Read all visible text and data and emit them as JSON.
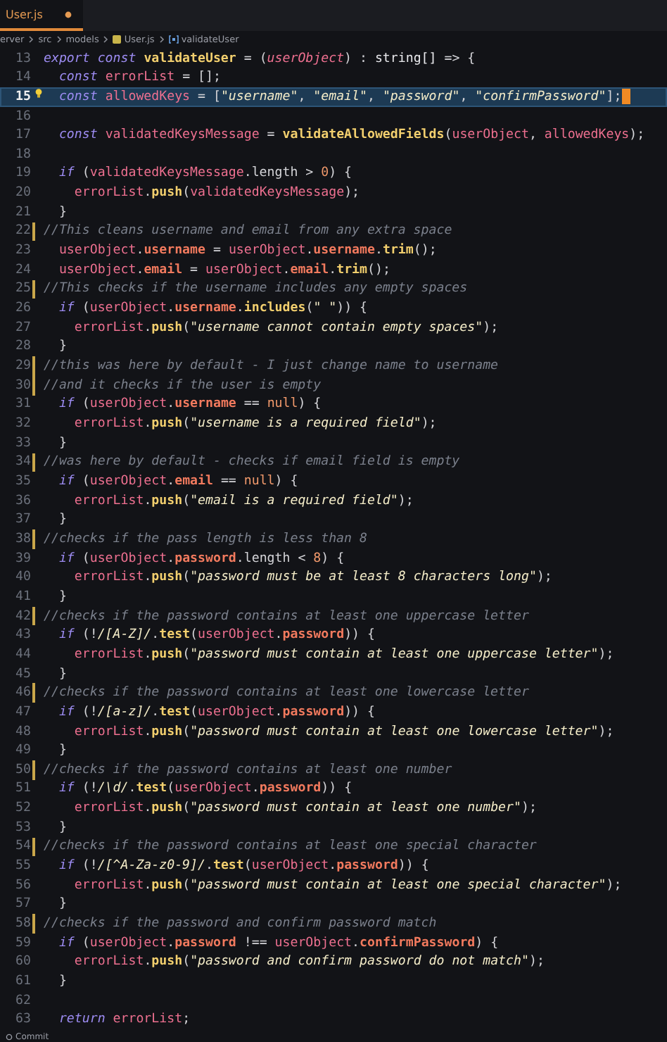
{
  "tab": {
    "label": "User.js",
    "modified": true
  },
  "breadcrumb": [
    {
      "text": "erver",
      "kind": "folder"
    },
    {
      "text": "src",
      "kind": "folder"
    },
    {
      "text": "models",
      "kind": "folder"
    },
    {
      "text": "User.js",
      "kind": "file"
    },
    {
      "text": "validateUser",
      "kind": "symbol"
    }
  ],
  "editor": {
    "lines": [
      {
        "number": "13",
        "selected": false,
        "modified": false,
        "tokens": [
          {
            "kind": "keyword",
            "text": "export const "
          },
          {
            "kind": "function",
            "text": "validateUser"
          },
          {
            "kind": "punct",
            "text": " = ("
          },
          {
            "kind": "param",
            "text": "userObject"
          },
          {
            "kind": "punct",
            "text": ") : "
          },
          {
            "kind": "type",
            "text": "string[]"
          },
          {
            "kind": "punct",
            "text": " => {"
          }
        ]
      },
      {
        "number": "14",
        "selected": false,
        "modified": false,
        "tokens": [
          {
            "kind": "keyword",
            "text": "  const "
          },
          {
            "kind": "variable",
            "text": "errorList"
          },
          {
            "kind": "punct",
            "text": " = [];"
          }
        ]
      },
      {
        "number": "15",
        "selected": true,
        "modified": false,
        "tokens": [
          {
            "kind": "keyword",
            "text": "  const "
          },
          {
            "kind": "variable",
            "text": "allowedKeys"
          },
          {
            "kind": "punct",
            "text": " = ["
          },
          {
            "kind": "string",
            "text": "\"username\""
          },
          {
            "kind": "punct",
            "text": ", "
          },
          {
            "kind": "string",
            "text": "\"email\""
          },
          {
            "kind": "punct",
            "text": ", "
          },
          {
            "kind": "string",
            "text": "\"password\""
          },
          {
            "kind": "punct",
            "text": ", "
          },
          {
            "kind": "string",
            "text": "\"confirmPassword\""
          },
          {
            "kind": "punct",
            "text": "];"
          }
        ]
      },
      {
        "number": "16",
        "selected": false,
        "modified": false
      },
      {
        "number": "17",
        "selected": false,
        "modified": false,
        "tokens": [
          {
            "kind": "keyword",
            "text": "  const "
          },
          {
            "kind": "variable",
            "text": "validatedKeysMessage"
          },
          {
            "kind": "punct",
            "text": " = "
          },
          {
            "kind": "function",
            "text": "validateAllowedFields"
          },
          {
            "kind": "punct",
            "text": "("
          },
          {
            "kind": "variable",
            "text": "userObject"
          },
          {
            "kind": "punct",
            "text": ", "
          },
          {
            "kind": "variable",
            "text": "allowedKeys"
          },
          {
            "kind": "punct",
            "text": ");"
          }
        ]
      },
      {
        "number": "18",
        "selected": false,
        "modified": false
      },
      {
        "number": "19",
        "selected": false,
        "modified": false,
        "tokens": [
          {
            "kind": "keyword",
            "text": "  if "
          },
          {
            "kind": "punct",
            "text": "("
          },
          {
            "kind": "variable",
            "text": "validatedKeysMessage"
          },
          {
            "kind": "punct",
            "text": ".length > "
          },
          {
            "kind": "number",
            "text": "0"
          },
          {
            "kind": "punct",
            "text": ") {"
          }
        ]
      },
      {
        "number": "20",
        "selected": false,
        "modified": false,
        "tokens": [
          {
            "kind": "variable",
            "text": "    errorList"
          },
          {
            "kind": "punct",
            "text": "."
          },
          {
            "kind": "function",
            "text": "push"
          },
          {
            "kind": "punct",
            "text": "("
          },
          {
            "kind": "variable",
            "text": "validatedKeysMessage"
          },
          {
            "kind": "punct",
            "text": ");"
          }
        ]
      },
      {
        "number": "21",
        "selected": false,
        "modified": false,
        "tokens": [
          {
            "kind": "punct",
            "text": "  }"
          }
        ]
      },
      {
        "number": "22",
        "selected": false,
        "modified": true,
        "tokens": [
          {
            "kind": "comment",
            "text": "//This cleans username and email from any extra space"
          }
        ]
      },
      {
        "number": "23",
        "selected": false,
        "modified": false,
        "tokens": [
          {
            "kind": "variable",
            "text": "  userObject"
          },
          {
            "kind": "punct",
            "text": "."
          },
          {
            "kind": "property",
            "text": "username"
          },
          {
            "kind": "punct",
            "text": " = "
          },
          {
            "kind": "variable",
            "text": "userObject"
          },
          {
            "kind": "punct",
            "text": "."
          },
          {
            "kind": "property",
            "text": "username"
          },
          {
            "kind": "punct",
            "text": "."
          },
          {
            "kind": "function",
            "text": "trim"
          },
          {
            "kind": "punct",
            "text": "();"
          }
        ]
      },
      {
        "number": "24",
        "selected": false,
        "modified": false,
        "tokens": [
          {
            "kind": "variable",
            "text": "  userObject"
          },
          {
            "kind": "punct",
            "text": "."
          },
          {
            "kind": "property",
            "text": "email"
          },
          {
            "kind": "punct",
            "text": " = "
          },
          {
            "kind": "variable",
            "text": "userObject"
          },
          {
            "kind": "punct",
            "text": "."
          },
          {
            "kind": "property",
            "text": "email"
          },
          {
            "kind": "punct",
            "text": "."
          },
          {
            "kind": "function",
            "text": "trim"
          },
          {
            "kind": "punct",
            "text": "();"
          }
        ]
      },
      {
        "number": "25",
        "selected": false,
        "modified": true,
        "tokens": [
          {
            "kind": "comment",
            "text": "//This checks if the username includes any empty spaces"
          }
        ]
      },
      {
        "number": "26",
        "selected": false,
        "modified": false,
        "tokens": [
          {
            "kind": "keyword",
            "text": "  if "
          },
          {
            "kind": "punct",
            "text": "("
          },
          {
            "kind": "variable",
            "text": "userObject"
          },
          {
            "kind": "punct",
            "text": "."
          },
          {
            "kind": "property",
            "text": "username"
          },
          {
            "kind": "punct",
            "text": "."
          },
          {
            "kind": "function",
            "text": "includes"
          },
          {
            "kind": "punct",
            "text": "("
          },
          {
            "kind": "string",
            "text": "\" \""
          },
          {
            "kind": "punct",
            "text": ")) {"
          }
        ]
      },
      {
        "number": "27",
        "selected": false,
        "modified": false,
        "tokens": [
          {
            "kind": "variable",
            "text": "    errorList"
          },
          {
            "kind": "punct",
            "text": "."
          },
          {
            "kind": "function",
            "text": "push"
          },
          {
            "kind": "punct",
            "text": "("
          },
          {
            "kind": "string",
            "text": "\"username cannot contain empty spaces\""
          },
          {
            "kind": "punct",
            "text": ");"
          }
        ]
      },
      {
        "number": "28",
        "selected": false,
        "modified": false,
        "tokens": [
          {
            "kind": "punct",
            "text": "  }"
          }
        ]
      },
      {
        "number": "29",
        "selected": false,
        "modified": true,
        "tokens": [
          {
            "kind": "comment",
            "text": "//this was here by default - I just change name to username"
          }
        ]
      },
      {
        "number": "30",
        "selected": false,
        "modified": true,
        "tokens": [
          {
            "kind": "comment",
            "text": "//and it checks if the user is empty"
          }
        ]
      },
      {
        "number": "31",
        "selected": false,
        "modified": false,
        "tokens": [
          {
            "kind": "keyword",
            "text": "  if "
          },
          {
            "kind": "punct",
            "text": "("
          },
          {
            "kind": "variable",
            "text": "userObject"
          },
          {
            "kind": "punct",
            "text": "."
          },
          {
            "kind": "property",
            "text": "username"
          },
          {
            "kind": "punct",
            "text": " == "
          },
          {
            "kind": "number",
            "text": "null"
          },
          {
            "kind": "punct",
            "text": ") {"
          }
        ]
      },
      {
        "number": "32",
        "selected": false,
        "modified": false,
        "tokens": [
          {
            "kind": "variable",
            "text": "    errorList"
          },
          {
            "kind": "punct",
            "text": "."
          },
          {
            "kind": "function",
            "text": "push"
          },
          {
            "kind": "punct",
            "text": "("
          },
          {
            "kind": "string",
            "text": "\"username is a required field\""
          },
          {
            "kind": "punct",
            "text": ");"
          }
        ]
      },
      {
        "number": "33",
        "selected": false,
        "modified": false,
        "tokens": [
          {
            "kind": "punct",
            "text": "  }"
          }
        ]
      },
      {
        "number": "34",
        "selected": false,
        "modified": true,
        "tokens": [
          {
            "kind": "comment",
            "text": "//was here by default - checks if email field is empty"
          }
        ]
      },
      {
        "number": "35",
        "selected": false,
        "modified": false,
        "tokens": [
          {
            "kind": "keyword",
            "text": "  if "
          },
          {
            "kind": "punct",
            "text": "("
          },
          {
            "kind": "variable",
            "text": "userObject"
          },
          {
            "kind": "punct",
            "text": "."
          },
          {
            "kind": "property",
            "text": "email"
          },
          {
            "kind": "punct",
            "text": " == "
          },
          {
            "kind": "number",
            "text": "null"
          },
          {
            "kind": "punct",
            "text": ") {"
          }
        ]
      },
      {
        "number": "36",
        "selected": false,
        "modified": false,
        "tokens": [
          {
            "kind": "variable",
            "text": "    errorList"
          },
          {
            "kind": "punct",
            "text": "."
          },
          {
            "kind": "function",
            "text": "push"
          },
          {
            "kind": "punct",
            "text": "("
          },
          {
            "kind": "string",
            "text": "\"email is a required field\""
          },
          {
            "kind": "punct",
            "text": ");"
          }
        ]
      },
      {
        "number": "37",
        "selected": false,
        "modified": false,
        "tokens": [
          {
            "kind": "punct",
            "text": "  }"
          }
        ]
      },
      {
        "number": "38",
        "selected": false,
        "modified": true,
        "tokens": [
          {
            "kind": "comment",
            "text": "//checks if the pass length is less than 8"
          }
        ]
      },
      {
        "number": "39",
        "selected": false,
        "modified": false,
        "tokens": [
          {
            "kind": "keyword",
            "text": "  if "
          },
          {
            "kind": "punct",
            "text": "("
          },
          {
            "kind": "variable",
            "text": "userObject"
          },
          {
            "kind": "punct",
            "text": "."
          },
          {
            "kind": "property",
            "text": "password"
          },
          {
            "kind": "punct",
            "text": ".length < "
          },
          {
            "kind": "number",
            "text": "8"
          },
          {
            "kind": "punct",
            "text": ") {"
          }
        ]
      },
      {
        "number": "40",
        "selected": false,
        "modified": false,
        "tokens": [
          {
            "kind": "variable",
            "text": "    errorList"
          },
          {
            "kind": "punct",
            "text": "."
          },
          {
            "kind": "function",
            "text": "push"
          },
          {
            "kind": "punct",
            "text": "("
          },
          {
            "kind": "string",
            "text": "\"password must be at least 8 characters long\""
          },
          {
            "kind": "punct",
            "text": ");"
          }
        ]
      },
      {
        "number": "41",
        "selected": false,
        "modified": false,
        "tokens": [
          {
            "kind": "punct",
            "text": "  }"
          }
        ]
      },
      {
        "number": "42",
        "selected": false,
        "modified": true,
        "tokens": [
          {
            "kind": "comment",
            "text": "//checks if the password contains at least one uppercase letter"
          }
        ]
      },
      {
        "number": "43",
        "selected": false,
        "modified": false,
        "tokens": [
          {
            "kind": "keyword",
            "text": "  if "
          },
          {
            "kind": "punct",
            "text": "(!"
          },
          {
            "kind": "regex",
            "text": "/[A-Z]/"
          },
          {
            "kind": "punct",
            "text": "."
          },
          {
            "kind": "function",
            "text": "test"
          },
          {
            "kind": "punct",
            "text": "("
          },
          {
            "kind": "variable",
            "text": "userObject"
          },
          {
            "kind": "punct",
            "text": "."
          },
          {
            "kind": "property",
            "text": "password"
          },
          {
            "kind": "punct",
            "text": ")) {"
          }
        ]
      },
      {
        "number": "44",
        "selected": false,
        "modified": false,
        "tokens": [
          {
            "kind": "variable",
            "text": "    errorList"
          },
          {
            "kind": "punct",
            "text": "."
          },
          {
            "kind": "function",
            "text": "push"
          },
          {
            "kind": "punct",
            "text": "("
          },
          {
            "kind": "string",
            "text": "\"password must contain at least one uppercase letter\""
          },
          {
            "kind": "punct",
            "text": ");"
          }
        ]
      },
      {
        "number": "45",
        "selected": false,
        "modified": false,
        "tokens": [
          {
            "kind": "punct",
            "text": "  }"
          }
        ]
      },
      {
        "number": "46",
        "selected": false,
        "modified": true,
        "tokens": [
          {
            "kind": "comment",
            "text": "//checks if the password contains at least one lowercase letter"
          }
        ]
      },
      {
        "number": "47",
        "selected": false,
        "modified": false,
        "tokens": [
          {
            "kind": "keyword",
            "text": "  if "
          },
          {
            "kind": "punct",
            "text": "(!"
          },
          {
            "kind": "regex",
            "text": "/[a-z]/"
          },
          {
            "kind": "punct",
            "text": "."
          },
          {
            "kind": "function",
            "text": "test"
          },
          {
            "kind": "punct",
            "text": "("
          },
          {
            "kind": "variable",
            "text": "userObject"
          },
          {
            "kind": "punct",
            "text": "."
          },
          {
            "kind": "property",
            "text": "password"
          },
          {
            "kind": "punct",
            "text": ")) {"
          }
        ]
      },
      {
        "number": "48",
        "selected": false,
        "modified": false,
        "tokens": [
          {
            "kind": "variable",
            "text": "    errorList"
          },
          {
            "kind": "punct",
            "text": "."
          },
          {
            "kind": "function",
            "text": "push"
          },
          {
            "kind": "punct",
            "text": "("
          },
          {
            "kind": "string",
            "text": "\"password must contain at least one lowercase letter\""
          },
          {
            "kind": "punct",
            "text": ");"
          }
        ]
      },
      {
        "number": "49",
        "selected": false,
        "modified": false,
        "tokens": [
          {
            "kind": "punct",
            "text": "  }"
          }
        ]
      },
      {
        "number": "50",
        "selected": false,
        "modified": true,
        "tokens": [
          {
            "kind": "comment",
            "text": "//checks if the password contains at least one number"
          }
        ]
      },
      {
        "number": "51",
        "selected": false,
        "modified": false,
        "tokens": [
          {
            "kind": "keyword",
            "text": "  if "
          },
          {
            "kind": "punct",
            "text": "(!"
          },
          {
            "kind": "regex",
            "text": "/\\d/"
          },
          {
            "kind": "punct",
            "text": "."
          },
          {
            "kind": "function",
            "text": "test"
          },
          {
            "kind": "punct",
            "text": "("
          },
          {
            "kind": "variable",
            "text": "userObject"
          },
          {
            "kind": "punct",
            "text": "."
          },
          {
            "kind": "property",
            "text": "password"
          },
          {
            "kind": "punct",
            "text": ")) {"
          }
        ]
      },
      {
        "number": "52",
        "selected": false,
        "modified": false,
        "tokens": [
          {
            "kind": "variable",
            "text": "    errorList"
          },
          {
            "kind": "punct",
            "text": "."
          },
          {
            "kind": "function",
            "text": "push"
          },
          {
            "kind": "punct",
            "text": "("
          },
          {
            "kind": "string",
            "text": "\"password must contain at least one number\""
          },
          {
            "kind": "punct",
            "text": ");"
          }
        ]
      },
      {
        "number": "53",
        "selected": false,
        "modified": false,
        "tokens": [
          {
            "kind": "punct",
            "text": "  }"
          }
        ]
      },
      {
        "number": "54",
        "selected": false,
        "modified": true,
        "tokens": [
          {
            "kind": "comment",
            "text": "//checks if the password contains at least one special character"
          }
        ]
      },
      {
        "number": "55",
        "selected": false,
        "modified": false,
        "tokens": [
          {
            "kind": "keyword",
            "text": "  if "
          },
          {
            "kind": "punct",
            "text": "(!"
          },
          {
            "kind": "regex",
            "text": "/[^A-Za-z0-9]/"
          },
          {
            "kind": "punct",
            "text": "."
          },
          {
            "kind": "function",
            "text": "test"
          },
          {
            "kind": "punct",
            "text": "("
          },
          {
            "kind": "variable",
            "text": "userObject"
          },
          {
            "kind": "punct",
            "text": "."
          },
          {
            "kind": "property",
            "text": "password"
          },
          {
            "kind": "punct",
            "text": ")) {"
          }
        ]
      },
      {
        "number": "56",
        "selected": false,
        "modified": false,
        "tokens": [
          {
            "kind": "variable",
            "text": "    errorList"
          },
          {
            "kind": "punct",
            "text": "."
          },
          {
            "kind": "function",
            "text": "push"
          },
          {
            "kind": "punct",
            "text": "("
          },
          {
            "kind": "string",
            "text": "\"password must contain at least one special character\""
          },
          {
            "kind": "punct",
            "text": ");"
          }
        ]
      },
      {
        "number": "57",
        "selected": false,
        "modified": false,
        "tokens": [
          {
            "kind": "punct",
            "text": "  }"
          }
        ]
      },
      {
        "number": "58",
        "selected": false,
        "modified": true,
        "tokens": [
          {
            "kind": "comment",
            "text": "//checks if the password and confirm password match"
          }
        ]
      },
      {
        "number": "59",
        "selected": false,
        "modified": false,
        "tokens": [
          {
            "kind": "keyword",
            "text": "  if "
          },
          {
            "kind": "punct",
            "text": "("
          },
          {
            "kind": "variable",
            "text": "userObject"
          },
          {
            "kind": "punct",
            "text": "."
          },
          {
            "kind": "property",
            "text": "password"
          },
          {
            "kind": "punct",
            "text": " !== "
          },
          {
            "kind": "variable",
            "text": "userObject"
          },
          {
            "kind": "punct",
            "text": "."
          },
          {
            "kind": "property",
            "text": "confirmPassword"
          },
          {
            "kind": "punct",
            "text": ") {"
          }
        ]
      },
      {
        "number": "60",
        "selected": false,
        "modified": false,
        "tokens": [
          {
            "kind": "variable",
            "text": "    errorList"
          },
          {
            "kind": "punct",
            "text": "."
          },
          {
            "kind": "function",
            "text": "push"
          },
          {
            "kind": "punct",
            "text": "("
          },
          {
            "kind": "string",
            "text": "\"password and confirm password do not match\""
          },
          {
            "kind": "punct",
            "text": ");"
          }
        ]
      },
      {
        "number": "61",
        "selected": false,
        "modified": false,
        "tokens": [
          {
            "kind": "punct",
            "text": "  }"
          }
        ]
      },
      {
        "number": "62",
        "selected": false,
        "modified": false
      },
      {
        "number": "63",
        "selected": false,
        "modified": false,
        "tokens": [
          {
            "kind": "keyword",
            "text": "  return "
          },
          {
            "kind": "variable",
            "text": "errorList"
          },
          {
            "kind": "punct",
            "text": ";"
          }
        ]
      }
    ]
  },
  "status_bar": {
    "label": "Commit"
  }
}
